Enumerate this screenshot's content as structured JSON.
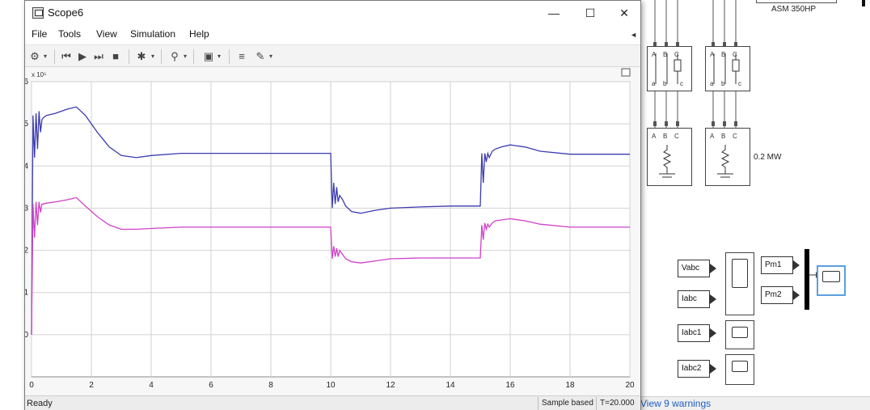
{
  "window": {
    "title": "Scope6",
    "minimize_glyph": "—",
    "maximize_glyph": "☐",
    "close_glyph": "✕"
  },
  "menu": [
    "File",
    "Tools",
    "View",
    "Simulation",
    "Help"
  ],
  "toolbar": {
    "icons": [
      "settings-icon",
      "step-back-icon",
      "run-icon",
      "step-forward-icon",
      "stop-icon",
      "highlight-icon",
      "zoom-icon",
      "fit-axes-icon",
      "cursor-measure-icon",
      "style-icon"
    ]
  },
  "status": {
    "ready": "Ready",
    "mode": "Sample based",
    "time": "T=20.000"
  },
  "chart_data": {
    "type": "line",
    "title": "",
    "xlabel": "",
    "ylabel": "",
    "xlim": [
      0,
      20
    ],
    "ylim": [
      -1,
      6
    ],
    "exponent_label": "x 10⁵",
    "xticks": [
      "0",
      "2",
      "4",
      "6",
      "8",
      "10",
      "12",
      "14",
      "16",
      "18",
      "20"
    ],
    "yticks": [
      "0",
      "1",
      "2",
      "3",
      "4",
      "5",
      "6"
    ],
    "grid": true,
    "background": "#ffffff",
    "series": [
      {
        "color": "#3b3bb0",
        "x": [
          0,
          0.05,
          0.1,
          0.15,
          0.2,
          0.25,
          0.3,
          0.35,
          0.4,
          0.5,
          0.8,
          1.2,
          1.5,
          1.8,
          2.2,
          2.6,
          3.0,
          3.5,
          4.0,
          5.0,
          6.0,
          8.0,
          10.0,
          10.05,
          10.1,
          10.15,
          10.2,
          10.25,
          10.3,
          10.4,
          10.5,
          10.7,
          11.0,
          11.5,
          12.0,
          13.0,
          14.0,
          15.0,
          15.05,
          15.1,
          15.15,
          15.2,
          15.25,
          15.3,
          15.4,
          15.5,
          15.7,
          16.0,
          16.5,
          17.0,
          18.0,
          19.0,
          20.0
        ],
        "values": [
          0,
          5.2,
          4.2,
          5.25,
          4.4,
          5.3,
          4.8,
          5.1,
          5.15,
          5.2,
          5.25,
          5.35,
          5.4,
          5.2,
          4.8,
          4.45,
          4.25,
          4.2,
          4.25,
          4.3,
          4.3,
          4.3,
          4.3,
          3.0,
          3.6,
          3.1,
          3.5,
          3.15,
          3.3,
          3.2,
          3.05,
          2.92,
          2.88,
          2.95,
          3.0,
          3.03,
          3.05,
          3.05,
          4.3,
          3.6,
          4.3,
          4.1,
          4.3,
          4.2,
          4.35,
          4.4,
          4.45,
          4.5,
          4.45,
          4.35,
          4.28,
          4.28,
          4.28
        ]
      },
      {
        "color": "#d040c8",
        "x": [
          0,
          0.05,
          0.1,
          0.15,
          0.2,
          0.25,
          0.3,
          0.35,
          0.4,
          0.5,
          0.8,
          1.2,
          1.5,
          1.8,
          2.2,
          2.6,
          3.0,
          3.5,
          4.0,
          5.0,
          6.0,
          8.0,
          10.0,
          10.05,
          10.1,
          10.15,
          10.2,
          10.25,
          10.3,
          10.4,
          10.5,
          10.7,
          11.0,
          11.5,
          12.0,
          13.0,
          14.0,
          15.0,
          15.05,
          15.1,
          15.15,
          15.2,
          15.25,
          15.3,
          15.4,
          15.5,
          15.7,
          16.0,
          16.5,
          17.0,
          18.0,
          19.0,
          20.0
        ],
        "values": [
          0,
          3.1,
          2.3,
          3.15,
          2.6,
          3.15,
          2.9,
          3.1,
          3.1,
          3.12,
          3.15,
          3.2,
          3.25,
          3.05,
          2.8,
          2.6,
          2.5,
          2.5,
          2.52,
          2.55,
          2.55,
          2.55,
          2.55,
          1.8,
          2.1,
          1.85,
          2.05,
          1.85,
          2.0,
          1.9,
          1.8,
          1.73,
          1.7,
          1.75,
          1.8,
          1.82,
          1.82,
          1.82,
          2.6,
          2.25,
          2.65,
          2.5,
          2.62,
          2.55,
          2.65,
          2.7,
          2.72,
          2.75,
          2.7,
          2.62,
          2.55,
          2.55,
          2.55
        ]
      }
    ]
  },
  "model": {
    "labels": {
      "asm": "ASM 350HP",
      "load": "0.2 MW",
      "warnings": "View 9 warnings"
    },
    "inports": [
      "Vabc",
      "Iabc",
      "Iabc1",
      "Iabc2"
    ],
    "pm_ports": [
      "Pm1",
      "Pm2"
    ],
    "breaker_letters": [
      "A",
      "B",
      "C",
      "a",
      "b",
      "c"
    ]
  }
}
